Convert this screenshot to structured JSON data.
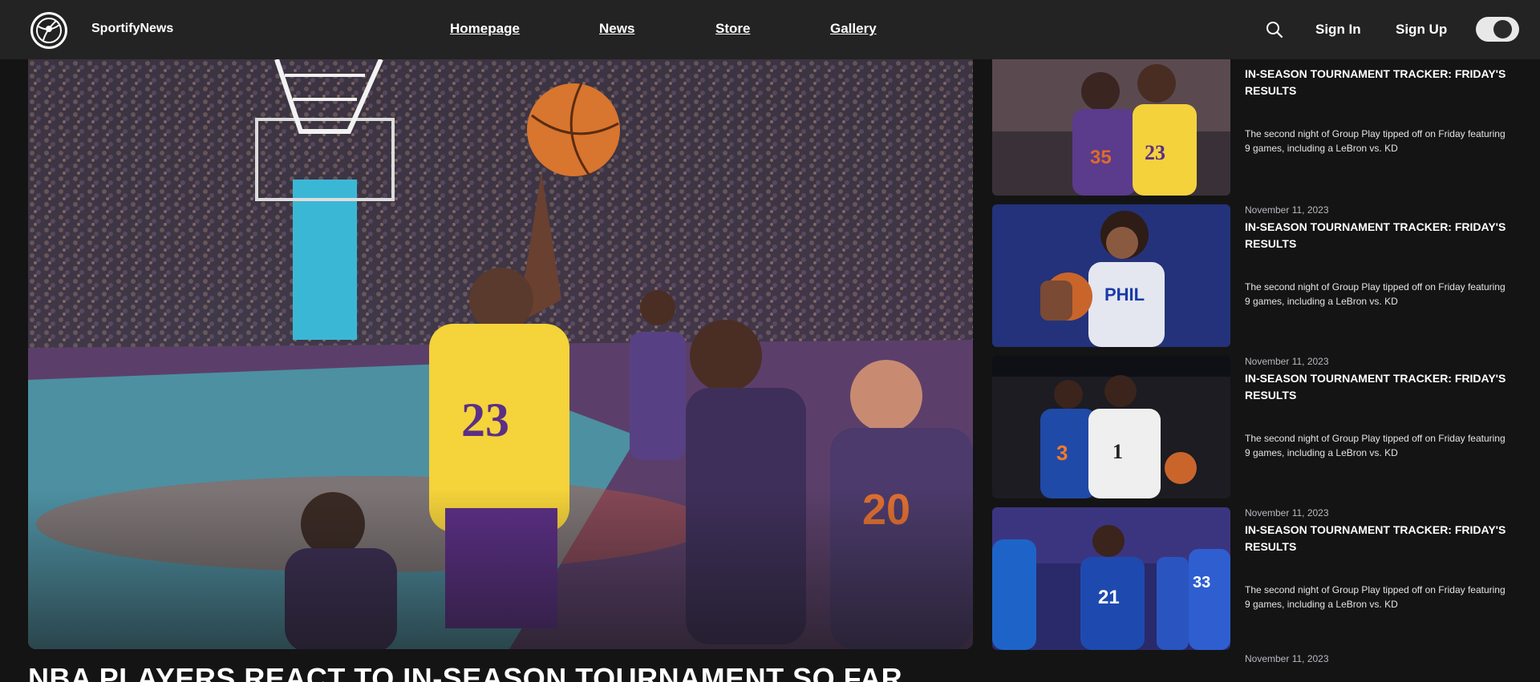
{
  "header": {
    "brand": "SportifyNews",
    "nav": [
      {
        "label": "Homepage"
      },
      {
        "label": "News"
      },
      {
        "label": "Store"
      },
      {
        "label": "Gallery"
      }
    ],
    "sign_in": "Sign In",
    "sign_up": "Sign Up",
    "icons": {
      "logo": "basketball-logo-icon",
      "search": "search-icon",
      "theme_toggle": "theme-toggle"
    }
  },
  "hero": {
    "title": "NBA PLAYERS REACT TO IN-SEASON TOURNAMENT SO FAR",
    "image_alt": "basketball-game-photo"
  },
  "sidebar": {
    "articles": [
      {
        "date": "",
        "title": "IN-SEASON TOURNAMENT TRACKER: FRIDAY'S RESULTS",
        "description": "The second night of Group Play tipped off on Friday featuring 9 games, including a LeBron vs. KD"
      },
      {
        "date": "November 11, 2023",
        "title": "IN-SEASON TOURNAMENT TRACKER: FRIDAY'S RESULTS",
        "description": "The second night of Group Play tipped off on Friday featuring 9 games, including a LeBron vs. KD"
      },
      {
        "date": "November 11, 2023",
        "title": "IN-SEASON TOURNAMENT TRACKER: FRIDAY'S RESULTS",
        "description": "The second night of Group Play tipped off on Friday featuring 9 games, including a LeBron vs. KD"
      },
      {
        "date": "November 11, 2023",
        "title": "IN-SEASON TOURNAMENT TRACKER: FRIDAY'S RESULTS",
        "description": "The second night of Group Play tipped off on Friday featuring 9 games, including a LeBron vs. KD"
      }
    ],
    "next_date": "November 11, 2023"
  },
  "colors": {
    "background": "#141414",
    "navbar": "#232323",
    "text": "#ffffff",
    "muted": "#b8b8c0"
  }
}
